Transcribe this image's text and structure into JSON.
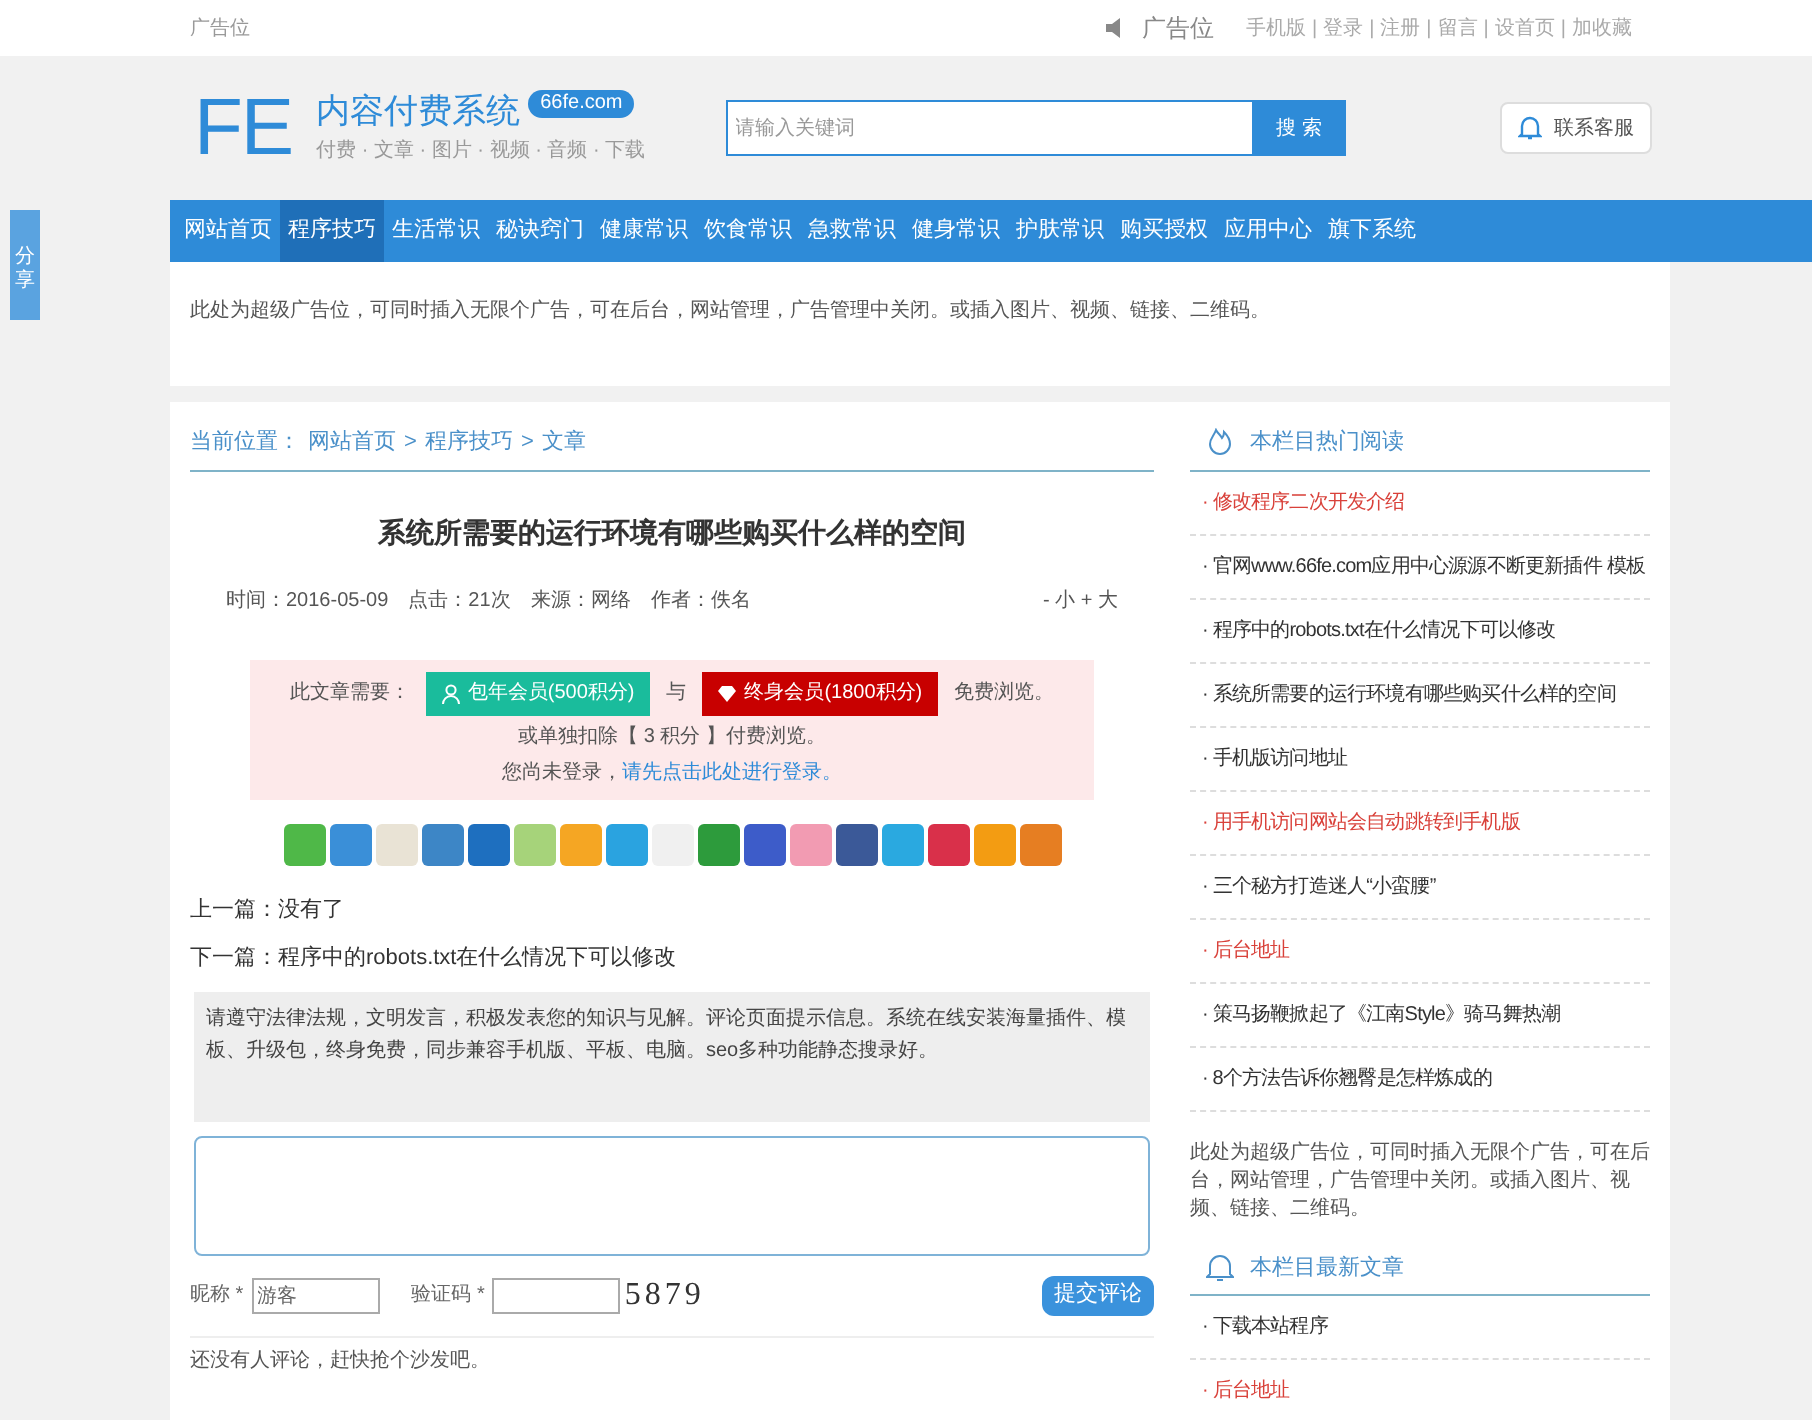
{
  "top_bar": {
    "ad_label": "广告位",
    "ad_title": "广告位",
    "link_separator": "|",
    "links": [
      "手机版",
      "登录",
      "注册",
      "留言",
      "设首页",
      "加收藏"
    ]
  },
  "header": {
    "logo_mark": "FE",
    "site_name": "内容付费系统",
    "domain_badge": "66fe.com",
    "tagline": "付费 · 文章 · 图片 · 视频 · 音频 · 下载",
    "search": {
      "placeholder": "请输入关键词",
      "button": "搜 索"
    },
    "contact_button": "联系客服"
  },
  "nav": [
    {
      "label": "网站首页",
      "selected": false
    },
    {
      "label": "程序技巧",
      "selected": true
    },
    {
      "label": "生活常识",
      "selected": false
    },
    {
      "label": "秘诀窍门",
      "selected": false
    },
    {
      "label": "健康常识",
      "selected": false
    },
    {
      "label": "饮食常识",
      "selected": false
    },
    {
      "label": "急救常识",
      "selected": false
    },
    {
      "label": "健身常识",
      "selected": false
    },
    {
      "label": "护肤常识",
      "selected": false
    },
    {
      "label": "购买授权",
      "selected": false
    },
    {
      "label": "应用中心",
      "selected": false
    },
    {
      "label": "旗下系统",
      "selected": false
    }
  ],
  "share_tab": "分享",
  "ad_banner": "此处为超级广告位，可同时插入无限个广告，可在后台，网站管理，广告管理中关闭。或插入图片、视频、链接、二维码。",
  "breadcrumb": {
    "label": "当前位置：",
    "separator": ">",
    "items": [
      "网站首页",
      "程序技巧",
      "文章"
    ]
  },
  "article": {
    "title": "系统所需要的运行环境有哪些购买什么样的空间",
    "meta": [
      "时间：2016-05-09",
      "点击：21次",
      "来源：网络",
      "作者：佚名"
    ],
    "font_size_controls": "- 小 + 大",
    "paywall": {
      "lead": "此文章需要：",
      "yearly_button": "包年会员(500积分)",
      "conjunction": "与",
      "lifetime_button": "终身会员(1800积分)",
      "suffix": "免费浏览。",
      "single_price": "或单独扣除【 3 积分 】付费浏览。",
      "login_prompt": "您尚未登录，",
      "login_link": "请先点击此处进行登录。"
    },
    "prev": "上一篇：没有了",
    "next": "下一篇：程序中的robots.txt在什么情况下可以修改"
  },
  "comments": {
    "rules_text": "请遵守法律法规，文明发言，积极发表您的知识与见解。评论页面提示信息。系统在线安装海量插件、模板、升级包，终身免费，同步兼容手机版、平板、电脑。seo多种功能静态搜录好。",
    "nickname_label": "昵称 *",
    "nickname_value": "游客",
    "captcha_label": "验证码 *",
    "captcha": "5879",
    "submit": "提交评论",
    "empty_notice": "还没有人评论，赶快抢个沙发吧。"
  },
  "sidebar": {
    "bullet": "·",
    "hot": {
      "title": "本栏目热门阅读",
      "items": [
        {
          "text": "修改程序二次开发介绍",
          "highlighted": true
        },
        {
          "text": "官网www.66fe.com应用中心源源不断更新插件 模板",
          "highlighted": false
        },
        {
          "text": "程序中的robots.txt在什么情况下可以修改",
          "highlighted": false
        },
        {
          "text": "系统所需要的运行环境有哪些购买什么样的空间",
          "highlighted": false
        },
        {
          "text": "手机版访问地址",
          "highlighted": false
        },
        {
          "text": "用手机访问网站会自动跳转到手机版",
          "highlighted": true
        },
        {
          "text": "三个秘方打造迷人“小蛮腰”",
          "highlighted": false
        },
        {
          "text": "后台地址",
          "highlighted": true
        },
        {
          "text": "策马扬鞭掀起了《江南Style》骑马舞热潮",
          "highlighted": false
        },
        {
          "text": "8个方法告诉你翘臀是怎样炼成的",
          "highlighted": false
        }
      ]
    },
    "ad_text": "此处为超级广告位，可同时插入无限个广告，可在后台，网站管理，广告管理中关闭。或插入图片、视频、链接、二维码。",
    "latest": {
      "title": "本栏目最新文章",
      "items": [
        {
          "text": "下载本站程序",
          "highlighted": false
        },
        {
          "text": "后台地址",
          "highlighted": true
        }
      ]
    }
  }
}
